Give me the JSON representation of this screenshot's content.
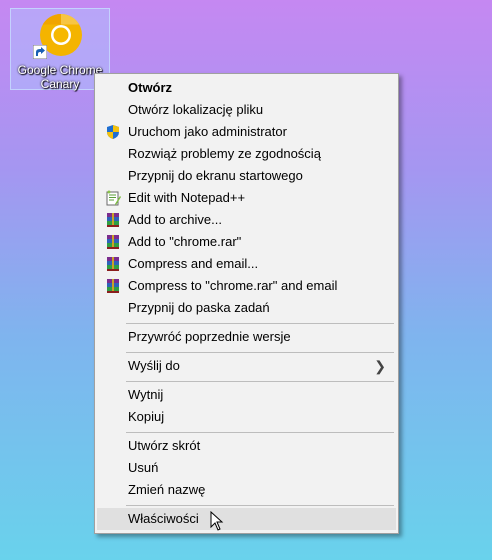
{
  "desktop": {
    "icon_label_line1": "Google Chrome",
    "icon_label_line2": "Canary",
    "icon_name": "chrome-canary-icon"
  },
  "context_menu": {
    "items": [
      {
        "label": "Otwórz",
        "bold": true
      },
      {
        "label": "Otwórz lokalizację pliku"
      },
      {
        "label": "Uruchom jako administrator",
        "icon": "uac-shield-icon"
      },
      {
        "label": "Rozwiąż problemy ze zgodnością"
      },
      {
        "label": "Przypnij do ekranu startowego"
      },
      {
        "label": "Edit with Notepad++",
        "icon": "notepadpp-icon"
      },
      {
        "label": "Add to archive...",
        "icon": "winrar-icon"
      },
      {
        "label": "Add to \"chrome.rar\"",
        "icon": "winrar-icon"
      },
      {
        "label": "Compress and email...",
        "icon": "winrar-icon"
      },
      {
        "label": "Compress to \"chrome.rar\" and email",
        "icon": "winrar-icon"
      },
      {
        "label": "Przypnij do paska zadań"
      },
      {
        "label": "Przywróć poprzednie wersje"
      },
      {
        "label": "Wyślij do",
        "submenu": true
      },
      {
        "label": "Wytnij"
      },
      {
        "label": "Kopiuj"
      },
      {
        "label": "Utwórz skrót"
      },
      {
        "label": "Usuń"
      },
      {
        "label": "Zmień nazwę"
      },
      {
        "label": "Właściwości",
        "highlighted": true
      }
    ]
  }
}
